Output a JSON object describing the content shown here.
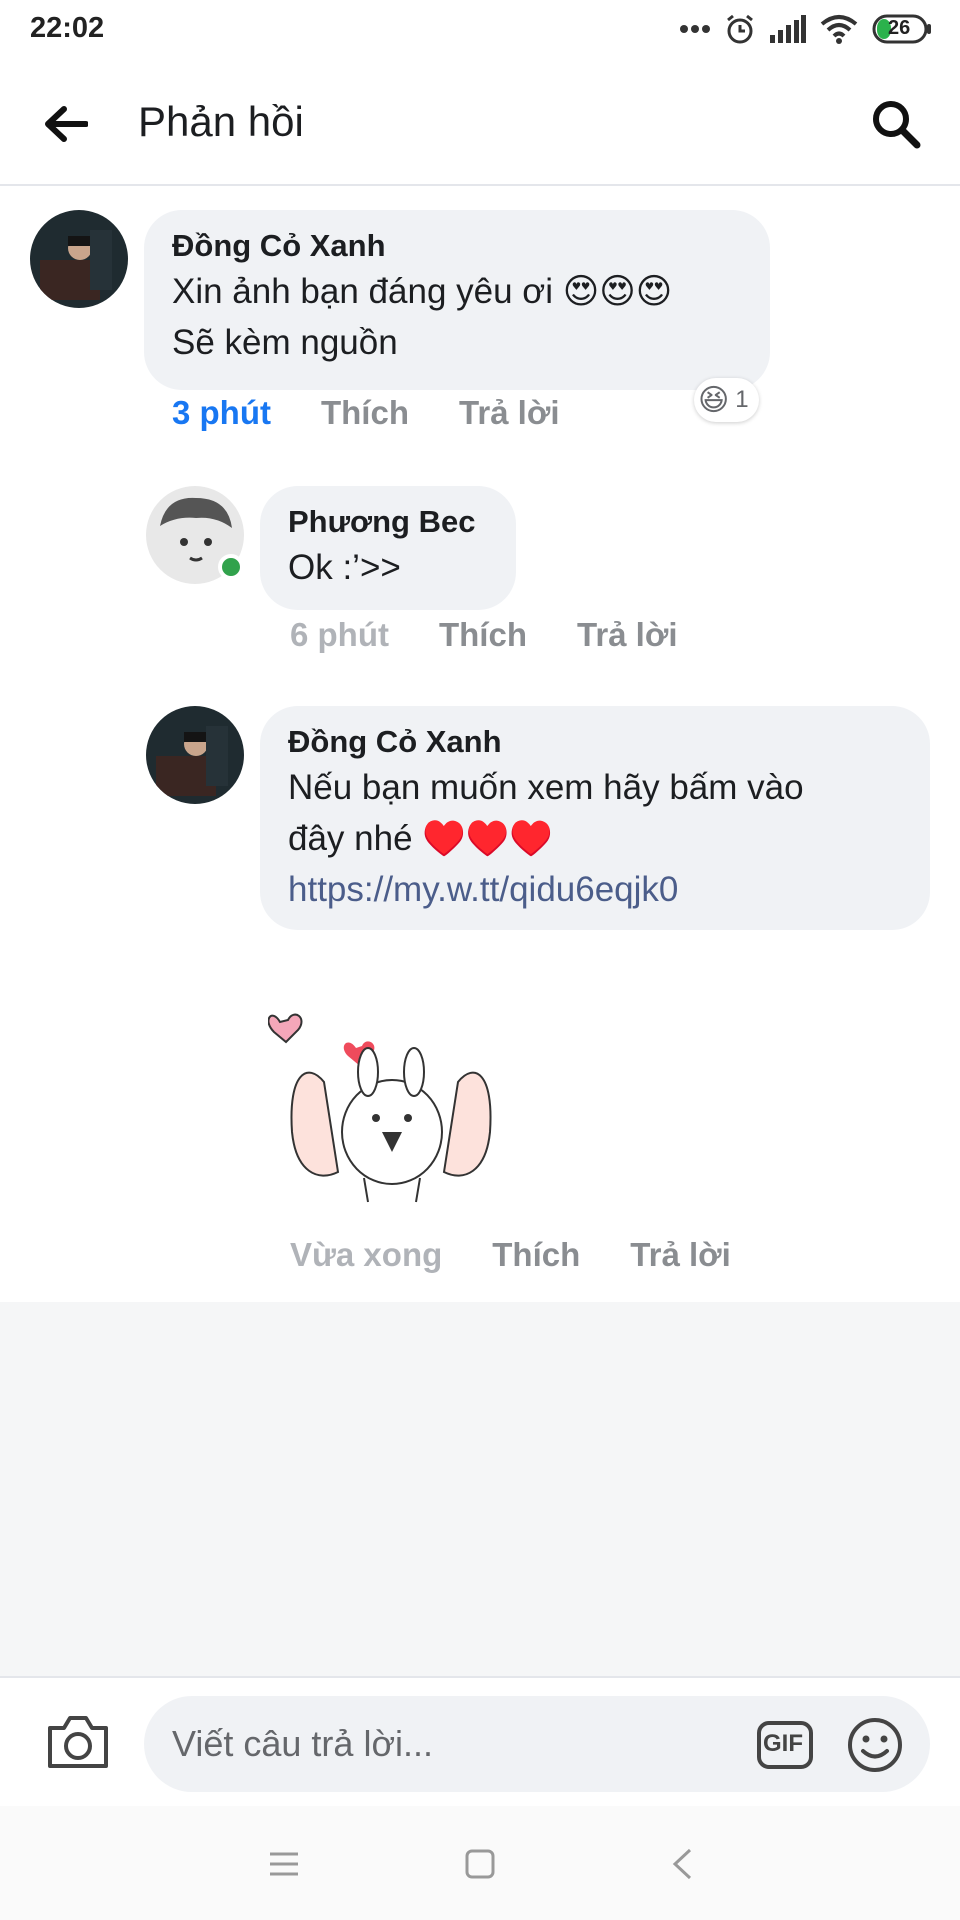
{
  "status_bar": {
    "time": "22:02",
    "battery": "26",
    "icons": [
      "more-dots-icon",
      "alarm-icon",
      "signal-icon",
      "wifi-icon",
      "battery-icon"
    ]
  },
  "header": {
    "title": "Phản hồi",
    "back_icon": "arrow-left-icon",
    "search_icon": "search-icon"
  },
  "comments": [
    {
      "author": "Đồng Cỏ Xanh",
      "lines": [
        "Xin ảnh bạn đáng yêu ơi 😍😍😍",
        "Sẽ kèm nguồn"
      ],
      "time": "3 phút",
      "like": "Thích",
      "reply": "Trả lời",
      "reaction_emoji": "😆",
      "reaction_count": "1"
    },
    {
      "author": "Phương Bec",
      "lines": [
        "Ok :’>>"
      ],
      "time": "6 phút",
      "like": "Thích",
      "reply": "Trả lời",
      "online": true
    },
    {
      "author": "Đồng Cỏ Xanh",
      "lines": [
        "Nếu bạn muốn xem hãy bấm vào",
        "đây nhé ♥️♥️♥️"
      ],
      "link": "https://my.w.tt/qidu6eqjk0",
      "sticker": "bunny-hearts-sticker",
      "time": "Vừa xong",
      "like": "Thích",
      "reply": "Trả lời"
    }
  ],
  "composer": {
    "placeholder": "Viết câu trả lời...",
    "gif_label": "GIF",
    "camera_icon": "camera-icon",
    "emoji_icon": "smiley-icon"
  },
  "nav": [
    "menu-icon",
    "home-square-icon",
    "back-chevron-icon"
  ],
  "colors": {
    "accent": "#1877f2",
    "bubble": "#f0f2f5",
    "meta_grey": "#8a8d91",
    "online": "#31a24c",
    "link": "#4b5d8a"
  }
}
